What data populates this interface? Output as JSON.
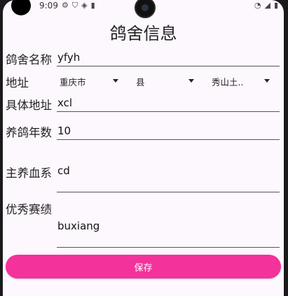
{
  "statusbar": {
    "time": "9:09"
  },
  "page": {
    "title": "鸽舍信息"
  },
  "form": {
    "loft_name_label": "鸽舍名称",
    "loft_name_value": "yfyh",
    "address_label": "地址",
    "province_value": "重庆市",
    "county_value": "县",
    "district_value": "秀山土..",
    "detail_address_label": "具体地址",
    "detail_address_value": "xcl",
    "years_label": "养鸽年数",
    "years_value": "10",
    "bloodline_label": "主养血系",
    "bloodline_value": "cd",
    "achievements_label": "优秀赛绩",
    "achievements_value": "buxiang"
  },
  "actions": {
    "save_label": "保存"
  }
}
